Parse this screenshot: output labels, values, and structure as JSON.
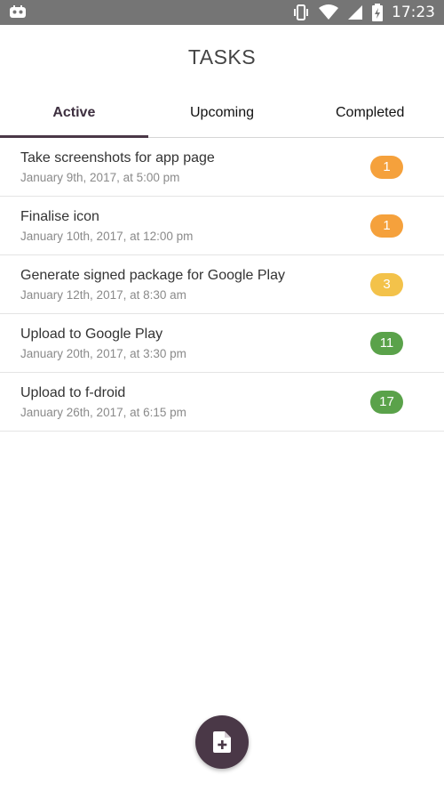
{
  "status_bar": {
    "time": "17:23",
    "icons": [
      "app-notification-icon",
      "vibrate-icon",
      "wifi-icon",
      "cell-signal-icon",
      "battery-icon"
    ]
  },
  "header": {
    "title": "TASKS"
  },
  "tabs": [
    {
      "label": "Active",
      "selected": true
    },
    {
      "label": "Upcoming",
      "selected": false
    },
    {
      "label": "Completed",
      "selected": false
    }
  ],
  "tasks": [
    {
      "title": "Take screenshots for app page",
      "date": "January 9th, 2017, at 5:00 pm",
      "badge": "1",
      "badge_color": "#f5a13c"
    },
    {
      "title": "Finalise icon",
      "date": "January 10th, 2017, at 12:00 pm",
      "badge": "1",
      "badge_color": "#f5a13c"
    },
    {
      "title": "Generate signed package for Google Play",
      "date": "January 12th, 2017, at 8:30 am",
      "badge": "3",
      "badge_color": "#f3c24a"
    },
    {
      "title": "Upload to Google Play",
      "date": "January 20th, 2017, at 3:30 pm",
      "badge": "11",
      "badge_color": "#5aa24a"
    },
    {
      "title": "Upload to f-droid",
      "date": "January 26th, 2017, at 6:15 pm",
      "badge": "17",
      "badge_color": "#5aa24a"
    }
  ],
  "fab": {
    "icon": "add-file-icon",
    "color": "#4a3847"
  }
}
